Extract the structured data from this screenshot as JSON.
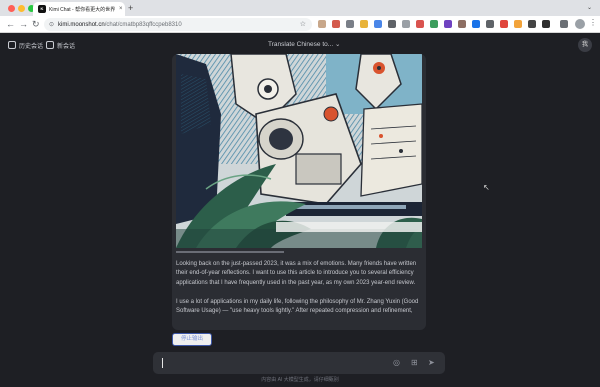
{
  "browser": {
    "tab_favicon": "K",
    "tab_title": "Kimi Chat - 帮你看更大的世界",
    "tab_close": "×",
    "new_tab": "+",
    "url_host": "kimi.moonshot.cn",
    "url_path": "/chat/cmatbp83qffccpeb8310",
    "icons": [
      "back-arrow-icon",
      "forward-arrow-icon",
      "reload-icon",
      "site-info-icon",
      "bookmark-star-icon",
      "kebab-menu-icon"
    ]
  },
  "app": {
    "history_label": "历史会话",
    "new_chat_label": "新会话",
    "model_label": "Translate Chinese to...",
    "model_chevron": "⌄",
    "avatar_text": "我"
  },
  "message": {
    "paragraph_1": "Looking back on the just-passed 2023, it was a mix of emotions. Many friends have written their end-of-year reflections. I want to use this article to introduce you to several efficiency applications that I have frequently used in the past year, as my own 2023 year-end review.",
    "paragraph_2": "I use a lot of applications in my daily life, following the philosophy of Mr. Zhang Yuxin (Good Software Usage) — \"use heavy tools lightly.\" After repeated compression and refinement,"
  },
  "actions": {
    "stop_label": "停止输出"
  },
  "composer": {
    "icons": [
      "globe-icon",
      "upload-file-icon",
      "send-icon"
    ]
  },
  "footer": {
    "disclaimer": "内容由 AI 大模型生成，请仔细甄别"
  },
  "colors": {
    "background": "#1e1f24",
    "bubble": "#2b2d33",
    "accent": "#3d57a8"
  }
}
